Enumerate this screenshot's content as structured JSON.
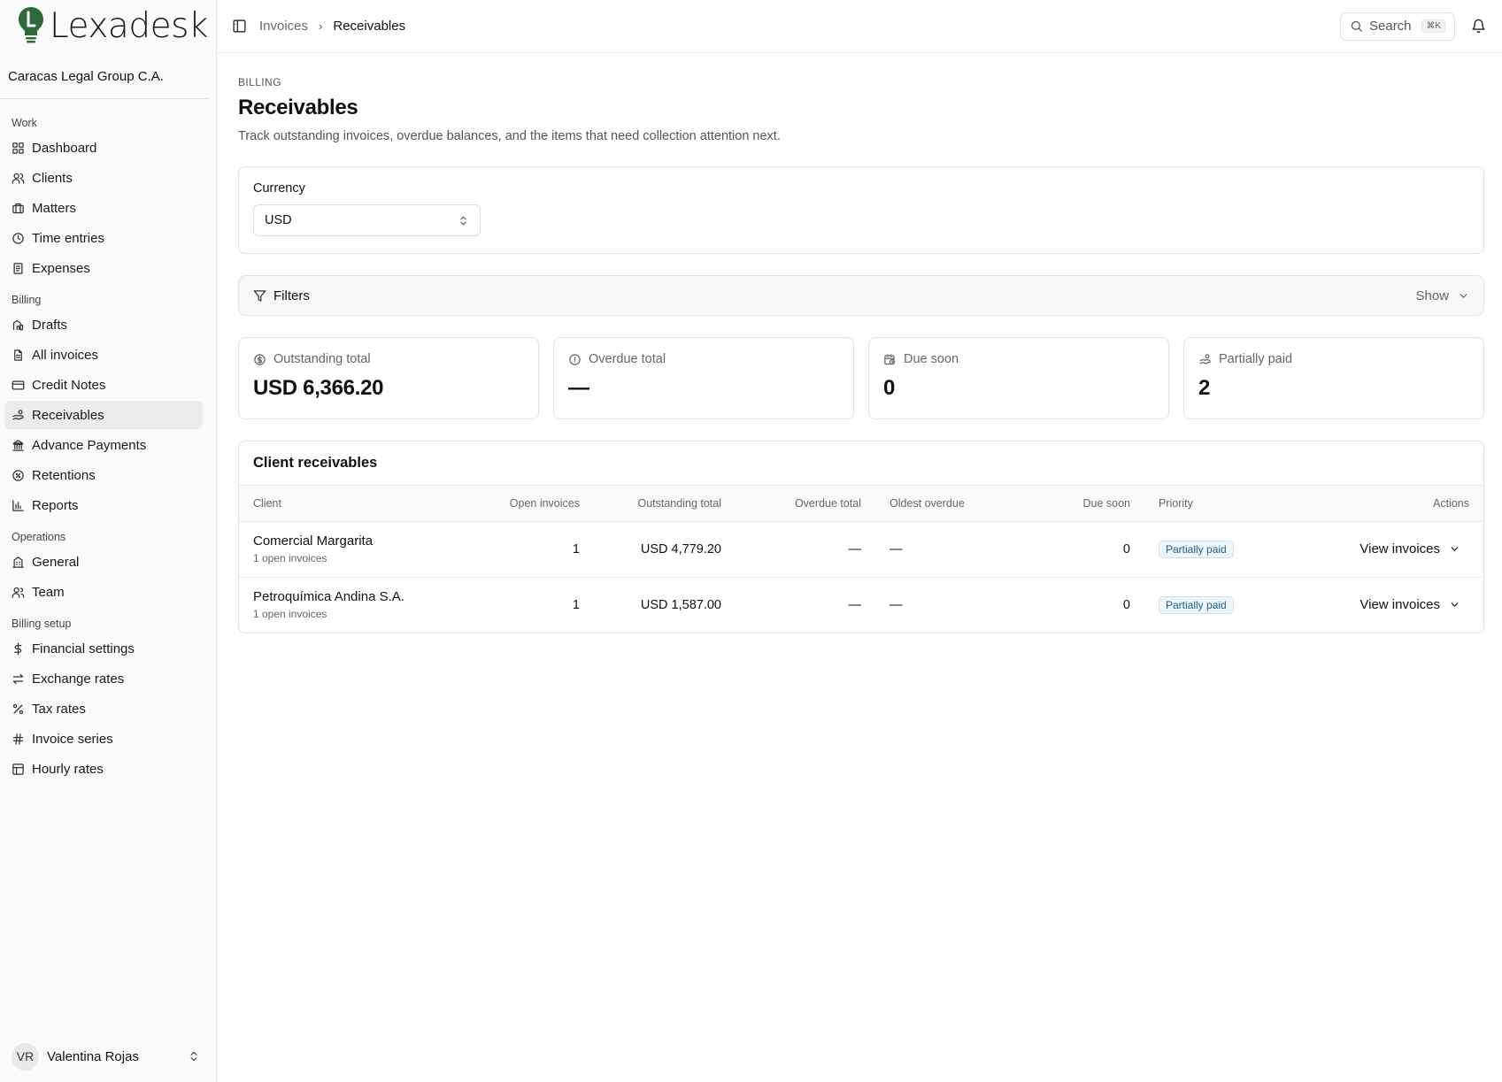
{
  "brand": {
    "name": "Lexadesk"
  },
  "org": {
    "name": "Caracas Legal Group C.A."
  },
  "sidebar": {
    "sections": [
      {
        "label": "Work",
        "items": [
          {
            "label": "Dashboard",
            "icon": "grid-icon"
          },
          {
            "label": "Clients",
            "icon": "users-icon"
          },
          {
            "label": "Matters",
            "icon": "briefcase-icon"
          },
          {
            "label": "Time entries",
            "icon": "clock-icon"
          },
          {
            "label": "Expenses",
            "icon": "receipt-icon"
          }
        ]
      },
      {
        "label": "Billing",
        "items": [
          {
            "label": "Drafts",
            "icon": "drafts-icon"
          },
          {
            "label": "All invoices",
            "icon": "file-icon"
          },
          {
            "label": "Credit Notes",
            "icon": "card-icon"
          },
          {
            "label": "Receivables",
            "icon": "handcoins-icon",
            "active": true
          },
          {
            "label": "Advance Payments",
            "icon": "bank-icon"
          },
          {
            "label": "Retentions",
            "icon": "badge-percent-icon"
          },
          {
            "label": "Reports",
            "icon": "bar-chart-icon"
          }
        ]
      },
      {
        "label": "Operations",
        "items": [
          {
            "label": "General",
            "icon": "building-icon"
          },
          {
            "label": "Team",
            "icon": "team-icon"
          }
        ]
      },
      {
        "label": "Billing setup",
        "items": [
          {
            "label": "Financial settings",
            "icon": "dollar-icon"
          },
          {
            "label": "Exchange rates",
            "icon": "arrows-icon"
          },
          {
            "label": "Tax rates",
            "icon": "percent-icon"
          },
          {
            "label": "Invoice series",
            "icon": "hash-icon"
          },
          {
            "label": "Hourly rates",
            "icon": "table-icon"
          }
        ]
      }
    ]
  },
  "user": {
    "initials": "VR",
    "name": "Valentina Rojas"
  },
  "topbar": {
    "breadcrumb": [
      "Invoices",
      "Receivables"
    ],
    "search_label": "Search",
    "search_shortcut": "⌘K"
  },
  "page": {
    "eyebrow": "BILLING",
    "title": "Receivables",
    "description": "Track outstanding invoices, overdue balances, and the items that need collection attention next."
  },
  "currency": {
    "label": "Currency",
    "value": "USD"
  },
  "filters": {
    "label": "Filters",
    "toggle_label": "Show"
  },
  "stats": [
    {
      "label": "Outstanding total",
      "value": "USD 6,366.20",
      "icon": "dollar-circle-icon"
    },
    {
      "label": "Overdue total",
      "value": "—",
      "icon": "alert-circle-icon"
    },
    {
      "label": "Due soon",
      "value": "0",
      "icon": "calendar-clock-icon"
    },
    {
      "label": "Partially paid",
      "value": "2",
      "icon": "handcoins-icon"
    }
  ],
  "table": {
    "title": "Client receivables",
    "columns": [
      "Client",
      "Open invoices",
      "Outstanding total",
      "Overdue total",
      "Oldest overdue",
      "Due soon",
      "Priority",
      "Actions"
    ],
    "rows": [
      {
        "client": "Comercial Margarita",
        "sub": "1 open invoices",
        "open": "1",
        "outstanding": "USD 4,779.20",
        "overdue": "—",
        "oldest": "—",
        "due_soon": "0",
        "priority": "Partially paid",
        "action": "View invoices"
      },
      {
        "client": "Petroquímica Andina S.A.",
        "sub": "1 open invoices",
        "open": "1",
        "outstanding": "USD 1,587.00",
        "overdue": "—",
        "oldest": "—",
        "due_soon": "0",
        "priority": "Partially paid",
        "action": "View invoices"
      }
    ]
  }
}
